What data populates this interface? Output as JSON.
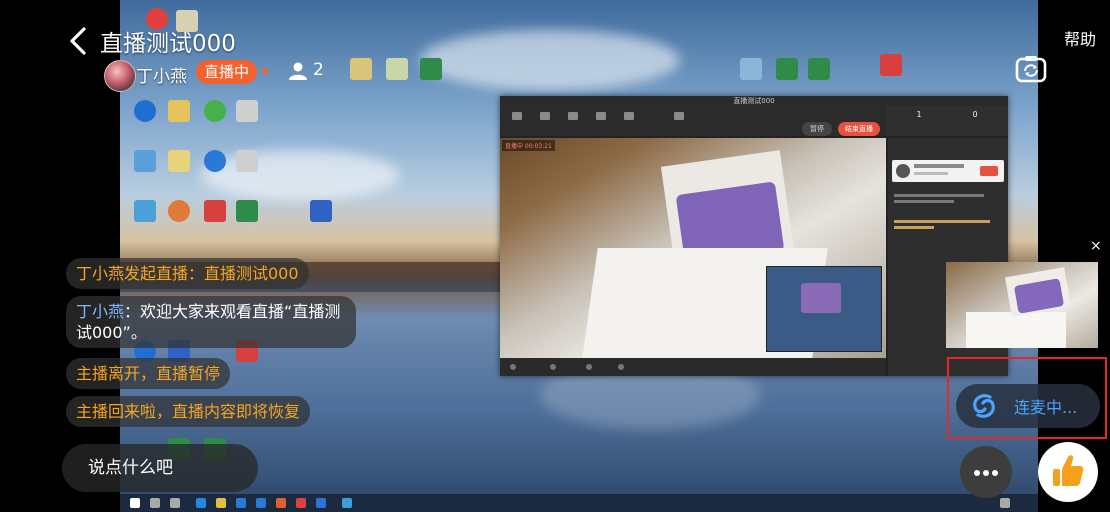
{
  "header": {
    "room_title": "直播测试000",
    "help_label": "帮助",
    "host_name": "丁小燕",
    "live_badge": "直播中",
    "viewer_count": "2"
  },
  "messages": [
    {
      "type": "system",
      "text": "丁小燕发起直播：直播测试000"
    },
    {
      "type": "chat",
      "name": "丁小燕",
      "sep": "：",
      "text": "欢迎大家来观看直播“直播测试000”。"
    },
    {
      "type": "system",
      "text": "主播离开，直播暂停"
    },
    {
      "type": "system",
      "text": "主播回来啦，直播内容即将恢复"
    }
  ],
  "footer": {
    "comment_placeholder": "说点什么吧",
    "more_label": "···"
  },
  "cohost": {
    "status_label": "连麦中..."
  },
  "pip": {
    "close_label": "×"
  },
  "shared_screen": {
    "window_title": "直播测试000",
    "pause_label": "暂停",
    "end_label": "结束直播",
    "stat_values": [
      "1",
      "0"
    ],
    "live_tag": "直播中 00:03:21"
  },
  "colors": {
    "live_badge": "#f2622e",
    "system_message": "#f5a623",
    "name_highlight": "#7fb8ff",
    "cohost_text": "#4aa3ff",
    "cohost_frame": "#e02b2b",
    "like_icon": "#f7a11a"
  },
  "icons": {
    "back": "chevron-left-icon",
    "viewer": "person-icon",
    "camera": "flip-camera-icon",
    "more": "ellipsis-icon",
    "like": "thumbs-up-icon",
    "cohost": "link-mic-icon",
    "close": "close-icon"
  }
}
